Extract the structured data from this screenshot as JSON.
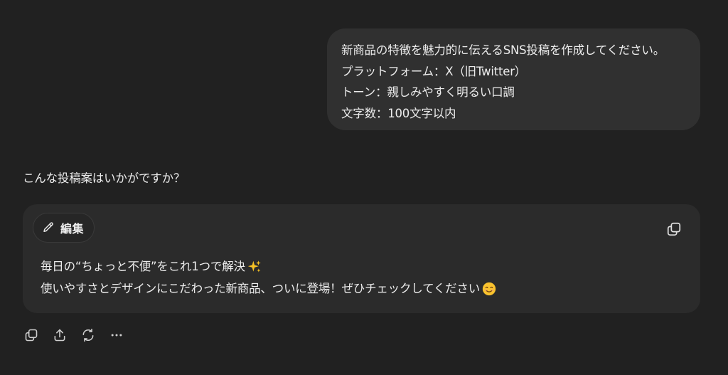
{
  "user_message": {
    "lines": [
      "新商品の特徴を魅力的に伝えるSNS投稿を作成してください。",
      "プラットフォーム：X（旧Twitter）",
      "トーン：親しみやすく明るい口調",
      "文字数：100文字以内"
    ]
  },
  "assistant": {
    "intro": "こんな投稿案はいかがですか？",
    "draft": {
      "edit_label": "編集",
      "line1": "毎日の“ちょっと不便”をこれ1つで解決",
      "line1_emoji": "sparkles",
      "line2": "使いやすさとデザインにこだわった新商品、ついに登場！ぜひチェックしてください",
      "line2_emoji": "smiling-face"
    }
  },
  "actions": [
    "copy-icon",
    "share-icon",
    "regenerate-icon",
    "more-icon"
  ],
  "colors": {
    "background": "#212121",
    "user_bubble": "#303030",
    "card": "#2b2b2b",
    "text": "#ececec",
    "icon": "#d0d0d0"
  }
}
